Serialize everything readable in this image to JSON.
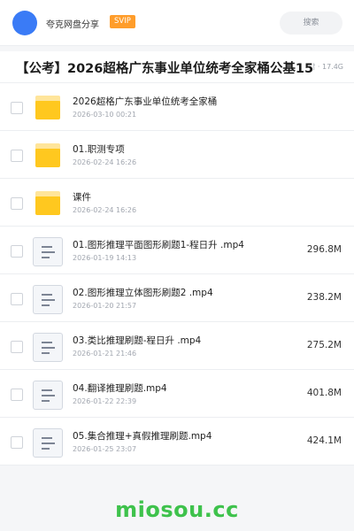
{
  "header": {
    "username": "夸克网盘分享",
    "badge": "SVIP",
    "search_label": "搜索",
    "accent_color": "#3a7bf6",
    "badge_color": "#ff9d2b"
  },
  "share": {
    "title": "【公考】2026超格广东事业单位统考全家桶公基15",
    "meta": "时 · 17.4G"
  },
  "files": [
    {
      "type": "folder",
      "name": "2026超格广东事业单位统考全家桶",
      "date": "2026-03-10 00:21",
      "size": ""
    },
    {
      "type": "folder",
      "name": "01.职测专项",
      "date": "2026-02-24 16:26",
      "size": ""
    },
    {
      "type": "folder",
      "name": "课件",
      "date": "2026-02-24 16:26",
      "size": ""
    },
    {
      "type": "video",
      "name": "01.图形推理平面图形刷题1-程日升 .mp4",
      "date": "2026-01-19 14:13",
      "size": "296.8M"
    },
    {
      "type": "video",
      "name": "02.图形推理立体图形刷题2 .mp4",
      "date": "2026-01-20 21:57",
      "size": "238.2M"
    },
    {
      "type": "video",
      "name": "03.类比推理刷题-程日升 .mp4",
      "date": "2026-01-21 21:46",
      "size": "275.2M"
    },
    {
      "type": "video",
      "name": "04.翻译推理刷题.mp4",
      "date": "2026-01-22 22:39",
      "size": "401.8M"
    },
    {
      "type": "video",
      "name": "05.集合推理+真假推理刷题.mp4",
      "date": "2026-01-25 23:07",
      "size": "424.1M"
    }
  ],
  "watermark": "miosou.cc"
}
